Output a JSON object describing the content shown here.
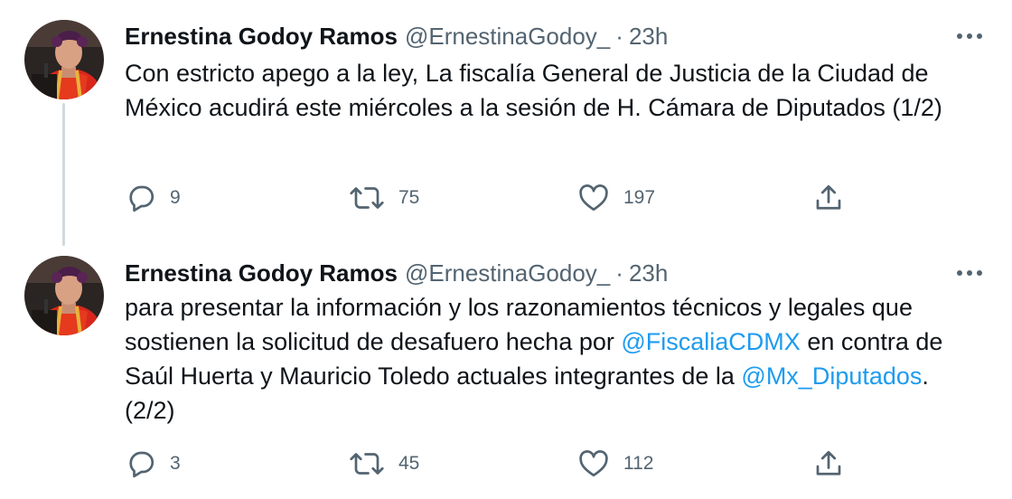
{
  "colors": {
    "text": "#0f1419",
    "secondary": "#536471",
    "link": "#1d9bf0",
    "thread_line": "#cfd9de",
    "background": "#ffffff"
  },
  "tweets": [
    {
      "display_name": "Ernestina Godoy Ramos",
      "handle": "@ErnestinaGodoy_",
      "separator": "·",
      "time": "23h",
      "avatar_icon": "profile-photo",
      "more_icon": "more-horizontal-icon",
      "text": "Con estricto apego a la ley, La fiscalía General de Justicia de la Ciudad de México acudirá este miércoles a la sesión de H. Cámara de Diputados (1/2)",
      "replies": "9",
      "retweets": "75",
      "likes": "197"
    },
    {
      "display_name": "Ernestina Godoy Ramos",
      "handle": "@ErnestinaGodoy_",
      "separator": "·",
      "time": "23h",
      "avatar_icon": "profile-photo",
      "more_icon": "more-horizontal-icon",
      "text_part1": "para presentar la información y los razonamientos técnicos y legales que sostienen la solicitud de desafuero hecha por ",
      "mention1": "@FiscaliaCDMX",
      "text_part2": " en contra de Saúl Huerta y Mauricio Toledo actuales integrantes de la ",
      "mention2": "@Mx_Diputados",
      "text_part3": ". (2/2)",
      "replies": "3",
      "retweets": "45",
      "likes": "112"
    }
  ],
  "action_icons": [
    "reply-icon",
    "retweet-icon",
    "like-icon",
    "share-icon"
  ]
}
